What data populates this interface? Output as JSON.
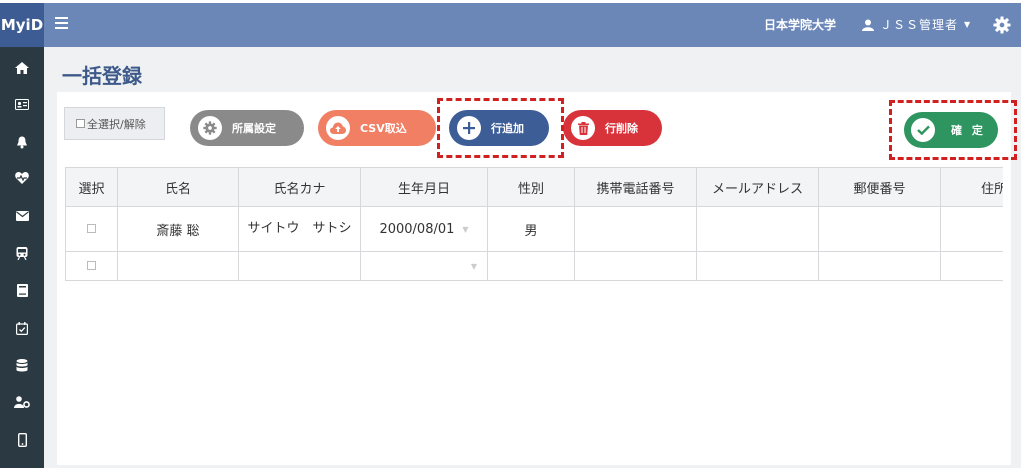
{
  "app": {
    "logo": "MyiD",
    "university": "日本学院大学",
    "user_name": "ＪＳＳ管理者"
  },
  "page": {
    "title": "一括登録"
  },
  "toolbar": {
    "select_all_label": "全選択/解除",
    "settings_label": "所属設定",
    "csv_label": "CSV取込",
    "add_row_label": "行追加",
    "delete_row_label": "行削除",
    "confirm_label": "確 定"
  },
  "colors": {
    "topbar": "#6b87b8",
    "sidebar": "#2b3a42",
    "settings": "#8a8a8a",
    "csv": "#f07f64",
    "add": "#3d5d96",
    "delete": "#d8333b",
    "confirm": "#2f9560",
    "highlight": "#d21f1f"
  },
  "sidebar": {
    "icons": [
      "home-icon",
      "id-card-icon",
      "bell-icon",
      "heart-pulse-icon",
      "mail-icon",
      "train-icon",
      "book-icon",
      "calendar-check-icon",
      "database-icon",
      "user-gear-icon",
      "mobile-icon"
    ]
  },
  "table": {
    "headers": [
      "選択",
      "氏名",
      "氏名カナ",
      "生年月日",
      "性別",
      "携帯電話番号",
      "メールアドレス",
      "郵便番号",
      "住所"
    ],
    "rows": [
      {
        "name": "斎藤 聡",
        "kana": "サイトウ　サトシ",
        "birthday": "2000/08/01",
        "gender": "男",
        "phone": "",
        "email": "",
        "postal": "",
        "address": ""
      },
      {
        "name": "",
        "kana": "",
        "birthday": "",
        "gender": "",
        "phone": "",
        "email": "",
        "postal": "",
        "address": ""
      }
    ]
  }
}
